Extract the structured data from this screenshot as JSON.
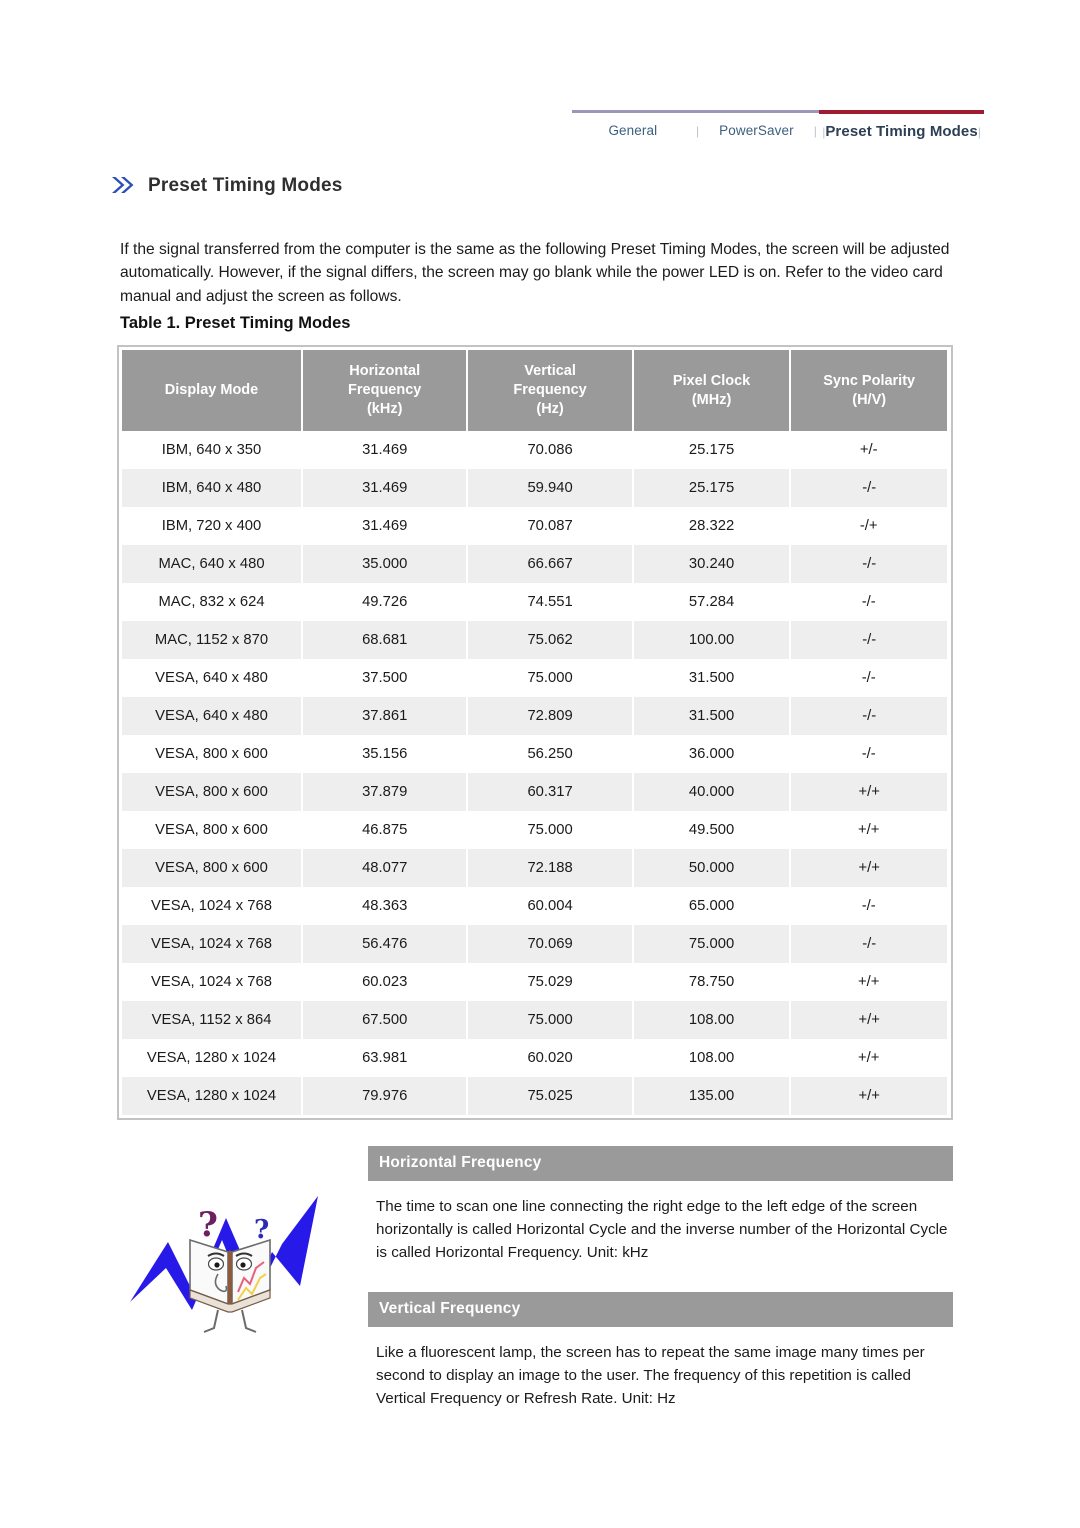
{
  "nav": {
    "tabs": [
      {
        "label": "General",
        "active": false
      },
      {
        "label": "PowerSaver",
        "active": false
      },
      {
        "label": "Preset Timing Modes",
        "active": true
      }
    ],
    "separator": "|",
    "edge_left": "|",
    "edge_right": "|",
    "active_rule_color": "#9e1b32",
    "inactive_rule_color": "#9a98b8"
  },
  "heading": {
    "icon": "double-chevron-icon",
    "title": "Preset Timing Modes"
  },
  "intro": "If the signal transferred from the computer is the same as the following Preset Timing Modes, the screen will be adjusted automatically. However, if the signal differs, the screen may go blank while the power LED is on. Refer to the video card manual and adjust the screen as follows.",
  "table": {
    "caption": "Table 1. Preset Timing Modes",
    "header_bg": "#9a9a9a",
    "stripe_bg": "#eeeeee",
    "columns": [
      "Display Mode",
      "Horizontal\nFrequency\n(kHz)",
      "Vertical\nFrequency\n(Hz)",
      "Pixel Clock\n(MHz)",
      "Sync Polarity\n(H/V)"
    ],
    "columns_lines": [
      [
        "Display Mode"
      ],
      [
        "Horizontal",
        "Frequency",
        "(kHz)"
      ],
      [
        "Vertical",
        "Frequency",
        "(Hz)"
      ],
      [
        "Pixel Clock",
        "(MHz)"
      ],
      [
        "Sync Polarity",
        "(H/V)"
      ]
    ],
    "rows": [
      [
        "IBM, 640 x 350",
        "31.469",
        "70.086",
        "25.175",
        "+/-"
      ],
      [
        "IBM, 640 x 480",
        "31.469",
        "59.940",
        "25.175",
        "-/-"
      ],
      [
        "IBM, 720 x 400",
        "31.469",
        "70.087",
        "28.322",
        "-/+"
      ],
      [
        "MAC, 640 x 480",
        "35.000",
        "66.667",
        "30.240",
        "-/-"
      ],
      [
        "MAC, 832 x 624",
        "49.726",
        "74.551",
        "57.284",
        "-/-"
      ],
      [
        "MAC, 1152 x 870",
        "68.681",
        "75.062",
        "100.00",
        "-/-"
      ],
      [
        "VESA, 640 x 480",
        "37.500",
        "75.000",
        "31.500",
        "-/-"
      ],
      [
        "VESA, 640 x 480",
        "37.861",
        "72.809",
        "31.500",
        "-/-"
      ],
      [
        "VESA, 800 x 600",
        "35.156",
        "56.250",
        "36.000",
        "-/-"
      ],
      [
        "VESA, 800 x 600",
        "37.879",
        "60.317",
        "40.000",
        "+/+"
      ],
      [
        "VESA, 800 x 600",
        "46.875",
        "75.000",
        "49.500",
        "+/+"
      ],
      [
        "VESA, 800 x 600",
        "48.077",
        "72.188",
        "50.000",
        "+/+"
      ],
      [
        "VESA, 1024 x 768",
        "48.363",
        "60.004",
        "65.000",
        "-/-"
      ],
      [
        "VESA, 1024 x 768",
        "56.476",
        "70.069",
        "75.000",
        "-/-"
      ],
      [
        "VESA, 1024 x 768",
        "60.023",
        "75.029",
        "78.750",
        "+/+"
      ],
      [
        "VESA, 1152 x 864",
        "67.500",
        "75.000",
        "108.00",
        "+/+"
      ],
      [
        "VESA, 1280 x 1024",
        "63.981",
        "60.020",
        "108.00",
        "+/+"
      ],
      [
        "VESA, 1280 x 1024",
        "79.976",
        "75.025",
        "135.00",
        "+/+"
      ]
    ]
  },
  "info_sections": [
    {
      "title": "Horizontal Frequency",
      "body": "The time to scan one line connecting the right edge to the left edge of the screen horizontally is called Horizontal Cycle and the inverse number of the Horizontal Cycle is called Horizontal Frequency. Unit: kHz"
    },
    {
      "title": "Vertical Frequency",
      "body": "Like a fluorescent lamp, the screen has to repeat the same image many times per second to display an image to the user. The frequency of this repetition is called Vertical Frequency or Refresh Rate. Unit: Hz"
    }
  ],
  "illustration": {
    "name": "open-book-character-with-question-marks-illustration"
  }
}
